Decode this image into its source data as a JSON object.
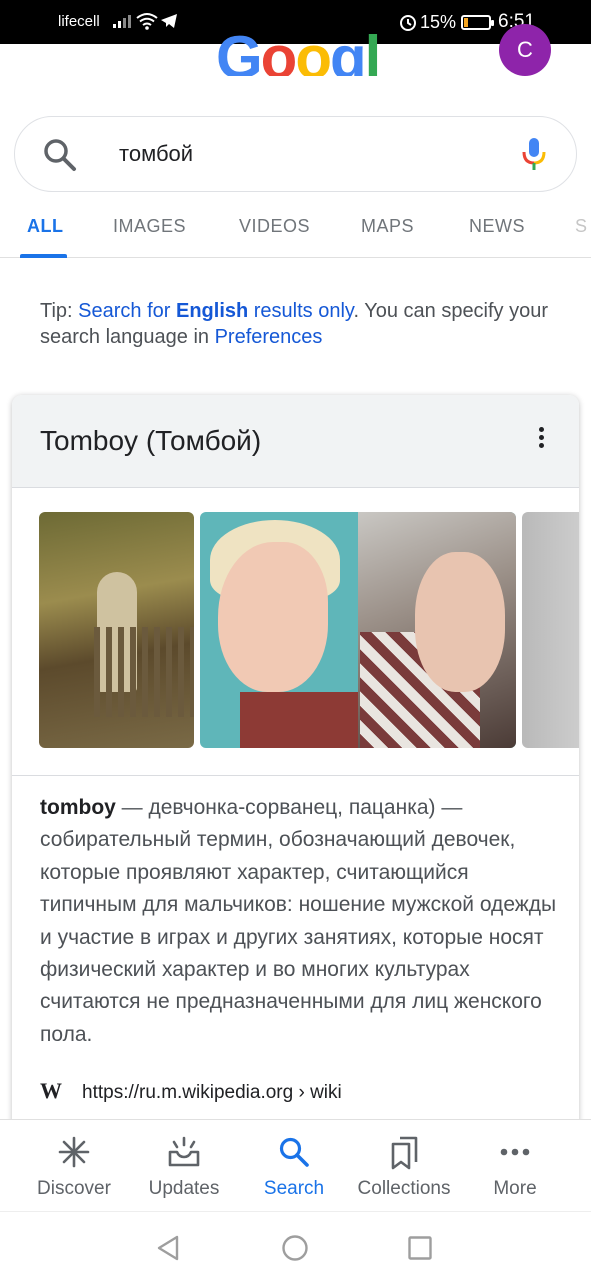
{
  "status_bar": {
    "carrier": "lifecell",
    "battery_percent": "15%",
    "battery_level": 0.15,
    "time": "6:51"
  },
  "header": {
    "logo": "Google",
    "avatar_letter": "C"
  },
  "search": {
    "query": "томбой"
  },
  "tabs": [
    {
      "label": "ALL",
      "active": true
    },
    {
      "label": "IMAGES"
    },
    {
      "label": "VIDEOS"
    },
    {
      "label": "MAPS"
    },
    {
      "label": "NEWS"
    },
    {
      "label": "S"
    }
  ],
  "tip": {
    "prefix": "Tip: ",
    "link1_a": "Search for ",
    "link1_bold": "English",
    "link1_b": " results only",
    "middle": ". You can specify your search language in ",
    "link2": "Preferences"
  },
  "knowledge_card": {
    "title": "Tomboy (Томбой)",
    "term": "tomboy",
    "description": " — девчонка-сорванец, пацанка) — собирательный термин, обозначающий девочек, которые проявляют характер, считающийся типичным для мальчиков: ношение мужской одежды и участие в играх и других занятиях, которые носят физический характер и во многих культурах считаются не предназначенными для лиц женского пола.",
    "source_icon": "W",
    "source_url": "https://ru.m.wikipedia.org › wiki"
  },
  "bottom_nav": [
    {
      "label": "Discover",
      "icon": "asterisk-icon"
    },
    {
      "label": "Updates",
      "icon": "updates-icon"
    },
    {
      "label": "Search",
      "icon": "search-icon",
      "active": true
    },
    {
      "label": "Collections",
      "icon": "collections-icon"
    },
    {
      "label": "More",
      "icon": "more-dots-icon"
    }
  ],
  "colors": {
    "accent": "#1a73e8",
    "avatar": "#8e24aa"
  }
}
